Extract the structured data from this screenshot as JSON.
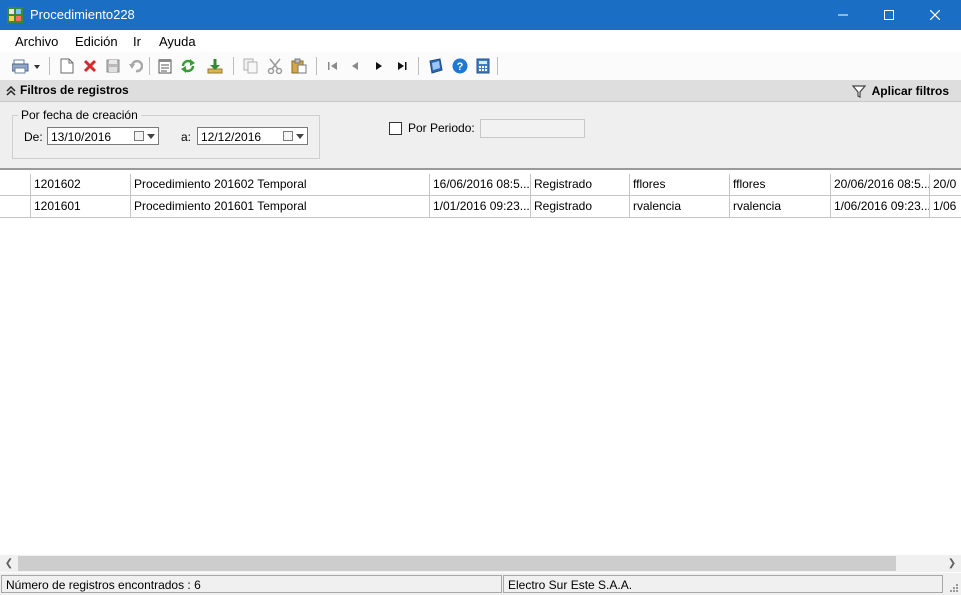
{
  "window": {
    "title": "Procedimiento228"
  },
  "menu": [
    "Archivo",
    "Edición",
    "Ir",
    "Ayuda"
  ],
  "toolbar": {
    "icons": [
      "print-icon",
      "new-document-icon",
      "delete-icon",
      "save-icon",
      "undo-icon",
      "notes-icon",
      "refresh-icon",
      "export-icon",
      "copy-icon",
      "cut-icon",
      "paste-icon",
      "first-record-icon",
      "previous-record-icon",
      "next-record-icon",
      "last-record-icon",
      "info-icon",
      "help-icon",
      "calculator-icon"
    ]
  },
  "filters": {
    "header": "Filtros de registros",
    "apply_label": "Aplicar filtros",
    "group_label": "Por fecha de creación",
    "from_label": "De:",
    "from_value": "13/10/2016",
    "to_label": "a:",
    "to_value": "12/12/2016",
    "period_label": "Por Periodo:",
    "period_checked": false,
    "period_value": ""
  },
  "grid": {
    "rows": [
      [
        "1201602",
        "Procedimiento 201602 Temporal",
        "16/06/2016 08:5...",
        "Registrado",
        "fflores",
        "fflores",
        "20/06/2016 08:5...",
        "20/0"
      ],
      [
        "1201601",
        "Procedimiento 201601 Temporal",
        "1/01/2016 09:23...",
        "Registrado",
        "rvalencia",
        "rvalencia",
        "1/06/2016 09:23...",
        "1/06"
      ]
    ]
  },
  "status": {
    "records": "Número de registros encontrados : 6",
    "company": "Electro Sur Este S.A.A."
  },
  "colors": {
    "titlebar": "#1a6fc4",
    "filterbar": "#dedede",
    "panel": "#efefef"
  }
}
